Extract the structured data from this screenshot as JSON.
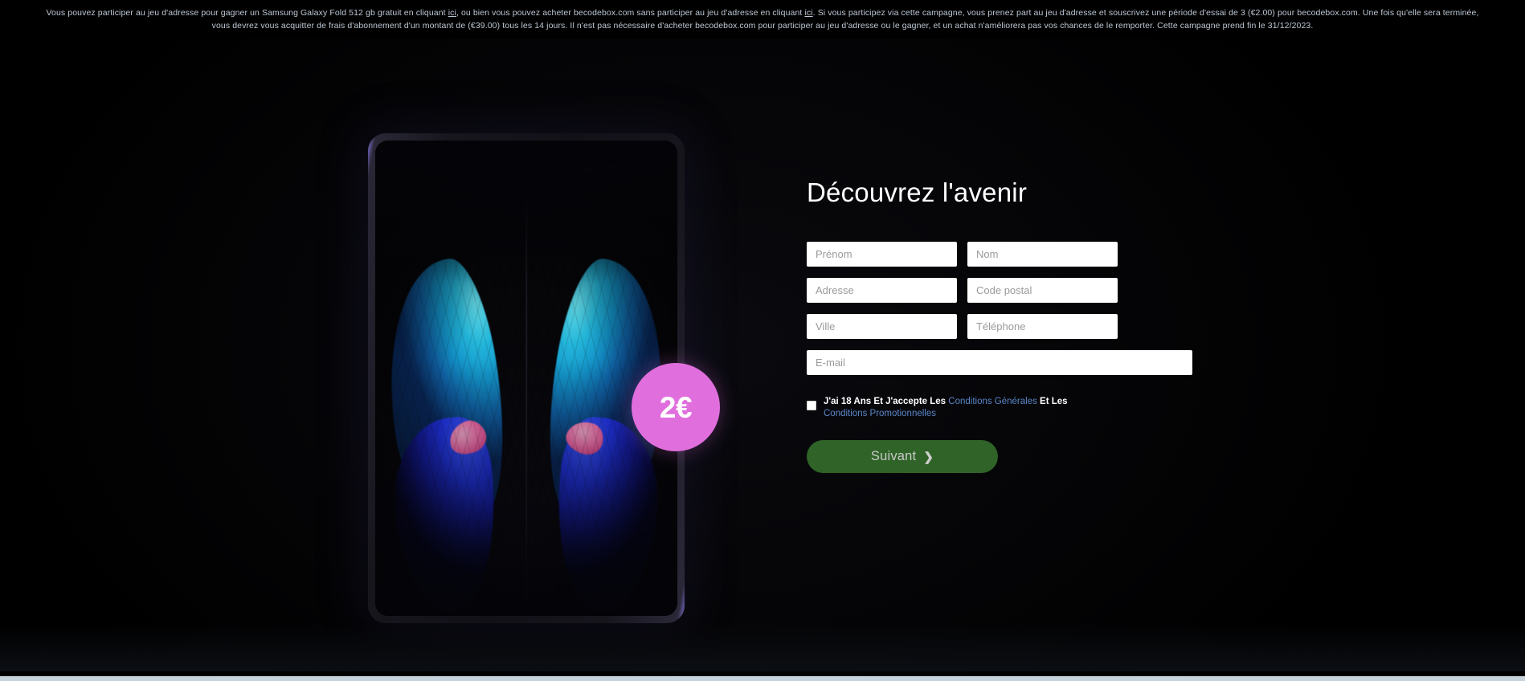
{
  "disclaimer": {
    "part1": "Vous pouvez participer au jeu d'adresse pour gagner un Samsung Galaxy Fold 512 gb gratuit en cliquant ",
    "link1": "ici",
    "part2": ", ou bien vous pouvez acheter becodebox.com sans participer au jeu d'adresse en cliquant ",
    "link2": "ici",
    "part3": ". Si vous participez via cette campagne, vous prenez part au jeu d'adresse et souscrivez une période d'essai de 3 (€2.00) pour becodebox.com. Une fois qu'elle sera terminée, vous devrez vous acquitter de frais d'abonnement d'un montant de (€39.00) tous les 14 jours. Il n'est pas nécessaire d'acheter becodebox.com pour participer au jeu d'adresse ou le gagner, et un achat n'améliorera pas vos chances de le remporter. Cette campagne prend fin le 31/12/2023."
  },
  "product": {
    "device_name": "Samsung Galaxy Fold",
    "wallpaper": "butterfly"
  },
  "badge": {
    "amount": "2€"
  },
  "form": {
    "title": "Découvrez l'avenir",
    "fields": [
      {
        "name": "first-name",
        "placeholder": "Prénom",
        "value": ""
      },
      {
        "name": "last-name",
        "placeholder": "Nom",
        "value": ""
      },
      {
        "name": "address",
        "placeholder": "Adresse",
        "value": ""
      },
      {
        "name": "postal-code",
        "placeholder": "Code postal",
        "value": ""
      },
      {
        "name": "city",
        "placeholder": "Ville",
        "value": ""
      },
      {
        "name": "phone",
        "placeholder": "Téléphone",
        "value": ""
      },
      {
        "name": "email",
        "placeholder": "E-mail",
        "value": ""
      }
    ],
    "terms": {
      "checked": false,
      "text_before": "J'ai 18 Ans Et J'accepte Les ",
      "link1": "Conditions Générales",
      "text_middle": " Et Les ",
      "link2": "Conditions Promotionnelles"
    },
    "submit": {
      "label": "Suivant",
      "chevron": "❯"
    }
  },
  "colors": {
    "page_background": "#000000",
    "badge_pink": "#e06fdd",
    "submit_green": "#2f6327",
    "link_blue": "#5b87c9",
    "disclaimer_text": "#bdc8d4",
    "footer_strip": "#c6d3dc"
  }
}
